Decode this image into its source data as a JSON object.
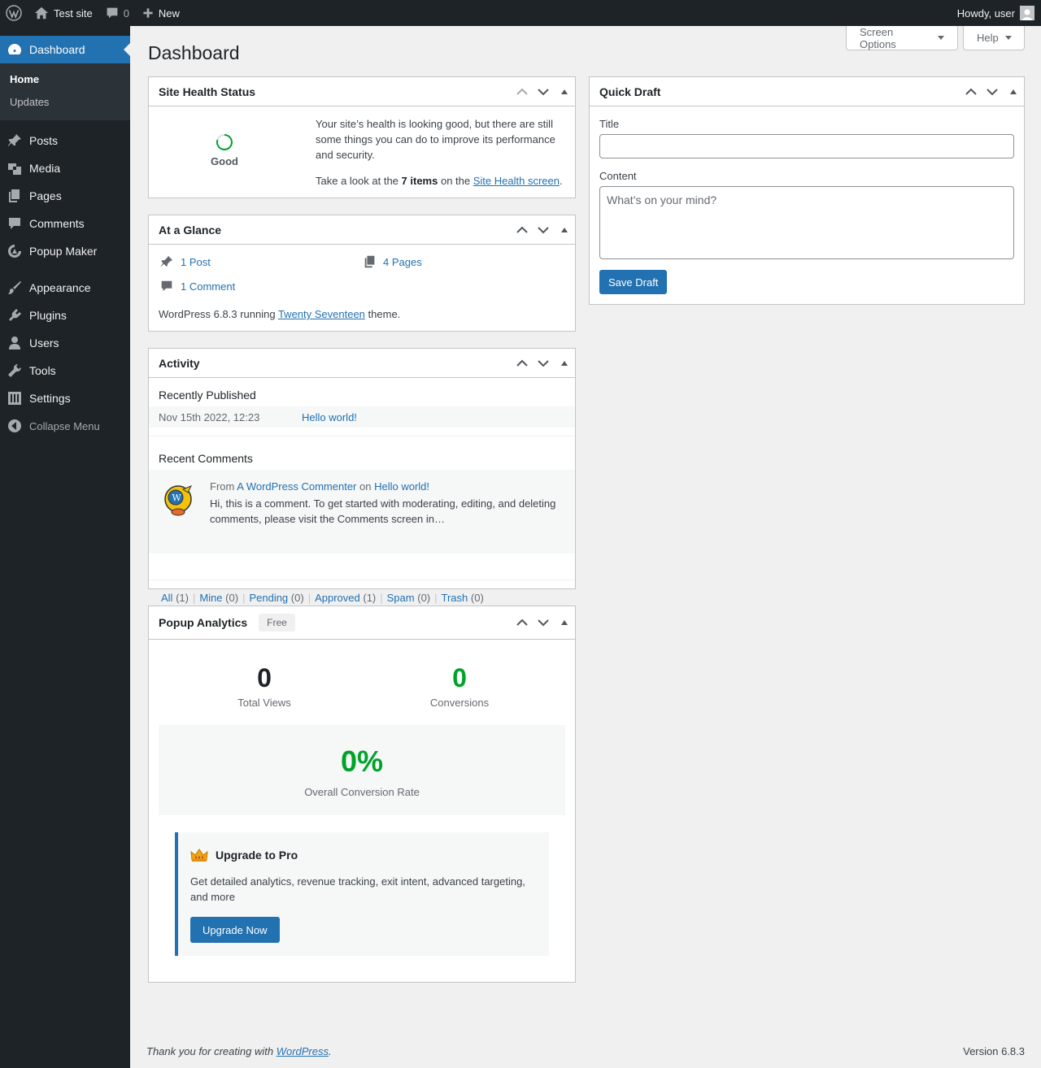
{
  "adminbar": {
    "site_name": "Test site",
    "comments_count": "0",
    "new_label": "New",
    "howdy": "Howdy, user"
  },
  "sidebar": {
    "dashboard": "Dashboard",
    "submenu": {
      "home": "Home",
      "updates": "Updates"
    },
    "items": [
      "Posts",
      "Media",
      "Pages",
      "Comments",
      "Popup Maker",
      "Appearance",
      "Plugins",
      "Users",
      "Tools",
      "Settings"
    ],
    "collapse": "Collapse Menu"
  },
  "header": {
    "title": "Dashboard",
    "screen_options": "Screen Options",
    "help": "Help"
  },
  "site_health": {
    "title": "Site Health Status",
    "status": "Good",
    "message": "Your site’s health is looking good, but there are still some things you can do to improve its performance and security.",
    "look_prefix": "Take a look at the",
    "items": "7 items",
    "look_mid": "on the",
    "link": "Site Health screen",
    "period": "."
  },
  "glance": {
    "title": "At a Glance",
    "posts": "1 Post",
    "pages": "4 Pages",
    "comments": "1 Comment",
    "wp_text": "WordPress 6.8.3 running",
    "theme": "Twenty Seventeen",
    "theme_suffix": "theme."
  },
  "activity": {
    "title": "Activity",
    "recently_published": "Recently Published",
    "post_date": "Nov 15th 2022, 12:23",
    "post_title": "Hello world!",
    "recent_comments": "Recent Comments",
    "from": "From",
    "author": "A WordPress Commenter",
    "on": "on",
    "comment_post": "Hello world!",
    "excerpt": "Hi, this is a comment. To get started with moderating, editing, and deleting comments, please visit the Comments screen in…",
    "filters": [
      {
        "label": "All",
        "count": "(1)"
      },
      {
        "label": "Mine",
        "count": "(0)"
      },
      {
        "label": "Pending",
        "count": "(0)"
      },
      {
        "label": "Approved",
        "count": "(1)"
      },
      {
        "label": "Spam",
        "count": "(0)"
      },
      {
        "label": "Trash",
        "count": "(0)"
      }
    ]
  },
  "popup": {
    "title": "Popup Analytics",
    "badge": "Free",
    "views": "0",
    "views_label": "Total Views",
    "conversions": "0",
    "conversions_label": "Conversions",
    "rate": "0%",
    "rate_label": "Overall Conversion Rate",
    "upgrade_title": "Upgrade to Pro",
    "upgrade_text": "Get detailed analytics, revenue tracking, exit intent, advanced targeting, and more",
    "upgrade_button": "Upgrade Now"
  },
  "quick_draft": {
    "title": "Quick Draft",
    "title_label": "Title",
    "title_value": "",
    "content_label": "Content",
    "content_placeholder": "What’s on your mind?",
    "save": "Save Draft"
  },
  "footer": {
    "thanks": "Thank you for creating with",
    "wp_link": "WordPress",
    "period": ".",
    "version": "Version 6.8.3"
  },
  "colors": {
    "accent": "#2271b1",
    "success": "#00a32a",
    "bar": "#1d2327"
  }
}
